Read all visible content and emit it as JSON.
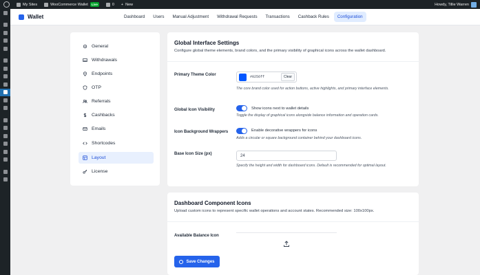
{
  "admin_bar": {
    "site_label": "My Sites",
    "store_label": "WooCommerce Wallet",
    "live_badge": "Live",
    "comments_count": "0",
    "new_label": "New",
    "greeting": "Howdy, Tillie Warren"
  },
  "header": {
    "title": "Wallet",
    "tabs": [
      {
        "label": "Dashboard"
      },
      {
        "label": "Users"
      },
      {
        "label": "Manual Adjustment"
      },
      {
        "label": "Withdrawal Requests"
      },
      {
        "label": "Transactions"
      },
      {
        "label": "Cashback Rules"
      },
      {
        "label": "Configuration",
        "active": true
      }
    ]
  },
  "settings_nav": {
    "items": [
      {
        "label": "General",
        "icon": "gear-icon"
      },
      {
        "label": "Withdrawals",
        "icon": "inbox-icon"
      },
      {
        "label": "Endpoints",
        "icon": "location-pin-icon"
      },
      {
        "label": "OTP",
        "icon": "shield-icon"
      },
      {
        "label": "Referrals",
        "icon": "people-icon"
      },
      {
        "label": "Cashbacks",
        "icon": "dollar-icon"
      },
      {
        "label": "Emails",
        "icon": "envelope-icon"
      },
      {
        "label": "Shortcodes",
        "icon": "code-icon"
      },
      {
        "label": "Layout",
        "icon": "layout-icon",
        "active": true
      },
      {
        "label": "License",
        "icon": "key-icon"
      }
    ]
  },
  "interface": {
    "title": "Global Interface Settings",
    "description": "Configure global theme elements, brand colors, and the primary visibility of graphical icons across the wallet dashboard.",
    "primary_color": {
      "label": "Primary Theme Color",
      "value": "#0256ff",
      "clear_label": "Clear",
      "help": "The core brand color used for action buttons, active highlights, and primary interface elements."
    },
    "icon_visibility": {
      "label": "Global Icon Visibility",
      "toggle_text": "Show icons next to wallet details",
      "enabled": true,
      "help": "Toggle the display of graphical icons alongside balance information and operation cards."
    },
    "icon_wrappers": {
      "label": "Icon Background Wrappers",
      "toggle_text": "Enable decorative wrappers for icons",
      "enabled": true,
      "help": "Adds a circular or square background container behind your dashboard icons."
    },
    "icon_size": {
      "label": "Base Icon Size (px)",
      "value": "24",
      "help": "Specify the height and width for dashboard icons. Default is recommended for optimal layout."
    }
  },
  "components": {
    "title": "Dashboard Component Icons",
    "description": "Upload custom icons to represent specific wallet operations and account states. Recommended size: 100x100px.",
    "balance_icon_label": "Available Balance Icon",
    "save_label": "Save Changes"
  },
  "colors": {
    "accent": "#2563eb",
    "admin_dark": "#1d2327",
    "active_tab_bg": "#e0ecff"
  }
}
